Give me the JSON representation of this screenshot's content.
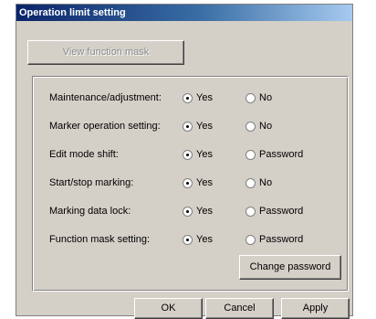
{
  "dialog": {
    "title": "Operation limit setting",
    "view_mask_label": "View function mask",
    "change_password_label": "Change password",
    "ok_label": "OK",
    "cancel_label": "Cancel",
    "apply_label": "Apply"
  },
  "settings": [
    {
      "label": "Maintenance/adjustment:",
      "yes": "Yes",
      "other": "No",
      "selected": "yes"
    },
    {
      "label": "Marker operation setting:",
      "yes": "Yes",
      "other": "No",
      "selected": "yes"
    },
    {
      "label": "Edit mode shift:",
      "yes": "Yes",
      "other": "Password",
      "selected": "yes"
    },
    {
      "label": "Start/stop marking:",
      "yes": "Yes",
      "other": "No",
      "selected": "yes"
    },
    {
      "label": "Marking data lock:",
      "yes": "Yes",
      "other": "Password",
      "selected": "yes"
    },
    {
      "label": "Function mask setting:",
      "yes": "Yes",
      "other": "Password",
      "selected": "yes"
    }
  ],
  "icons": [
    "radio-selected-icon",
    "radio-unselected-icon"
  ],
  "colors": {
    "face": "#d4d0c8",
    "title_start": "#0a246a",
    "title_end": "#a6caf0"
  }
}
